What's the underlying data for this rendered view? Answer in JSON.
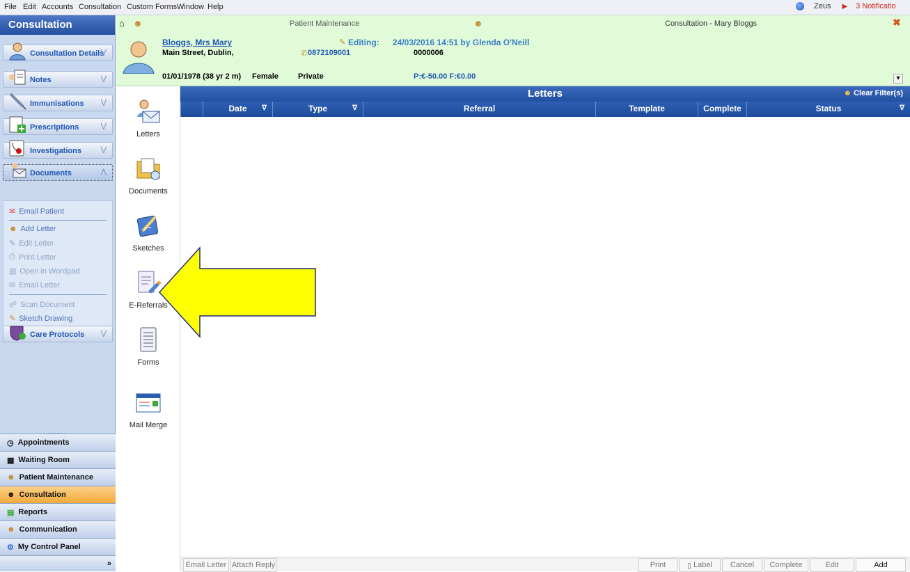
{
  "menu": {
    "items": [
      "File",
      "Edit",
      "Accounts",
      "Consultation",
      "Custom Forms",
      "Window",
      "Help"
    ],
    "user": "Zeus",
    "notifications": "3 Notificatio"
  },
  "sidebar": {
    "title": "Consultation",
    "sections": [
      {
        "label": "Consultation Details",
        "icon": "doctor-icon"
      },
      {
        "label": "Notes",
        "icon": "notes-icon"
      },
      {
        "label": "Immunisations",
        "icon": "syringe-icon"
      },
      {
        "label": "Prescriptions",
        "icon": "prescription-icon"
      },
      {
        "label": "Investigations",
        "icon": "stethoscope-icon"
      },
      {
        "label": "Documents",
        "icon": "documents-icon"
      },
      {
        "label": "Care Protocols",
        "icon": "care-protocols-icon"
      }
    ],
    "doc_items": [
      {
        "label": "Email Patient",
        "enabled": true
      },
      {
        "label": "Add Letter",
        "enabled": true
      },
      {
        "label": "Edit Letter",
        "enabled": false
      },
      {
        "label": "Print Letter",
        "enabled": false
      },
      {
        "label": "Open in Wordpad",
        "enabled": false
      },
      {
        "label": "Email Letter",
        "enabled": false
      },
      {
        "label": "Scan Document",
        "enabled": false
      },
      {
        "label": "Sketch Drawing",
        "enabled": true
      }
    ],
    "nav": [
      {
        "label": "Appointments",
        "active": false
      },
      {
        "label": "Waiting Room",
        "active": false
      },
      {
        "label": "Patient Maintenance",
        "active": false
      },
      {
        "label": "Consultation",
        "active": true
      },
      {
        "label": "Reports",
        "active": false
      },
      {
        "label": "Communication",
        "active": false
      },
      {
        "label": "My Control Panel",
        "active": false
      }
    ],
    "grip": "..........",
    "expand": "»"
  },
  "patient": {
    "tab_patient_maintenance": "Patient Maintenance",
    "tab_consultation": "Consultation - Mary Bloggs",
    "name": "Bloggs, Mrs Mary",
    "address": "Main Street, Dublin,",
    "phone": "0872109001",
    "editing_label": "Editing:",
    "editing_info": "24/03/2016 14:51 by Glenda O'Neill",
    "number": "0000006",
    "dob": "01/01/1978 (38 yr 2 m)",
    "sex": "Female",
    "type": "Private",
    "balance": "P:€-50.00 F:€0.00"
  },
  "icon_column": [
    {
      "label": "Letters",
      "icon": "letters-icon"
    },
    {
      "label": "Documents",
      "icon": "documents-folder-icon"
    },
    {
      "label": "Sketches",
      "icon": "sketches-icon"
    },
    {
      "label": "E-Referrals",
      "icon": "e-referrals-icon"
    },
    {
      "label": "Forms",
      "icon": "forms-icon"
    },
    {
      "label": "Mail Merge",
      "icon": "mail-merge-icon"
    }
  ],
  "main": {
    "title": "Letters",
    "clear_filters": "Clear Filter(s)",
    "columns": [
      "Date",
      "Type",
      "Referral",
      "Template",
      "Complete",
      "Status"
    ],
    "filter_glyph": "∇"
  },
  "bottom": {
    "left": [
      {
        "label": "Email Letter",
        "enabled": false
      },
      {
        "label": "Attach Reply",
        "enabled": false
      }
    ],
    "right": [
      {
        "label": "Print",
        "enabled": false
      },
      {
        "label": "Label",
        "enabled": false
      },
      {
        "label": "Cancel",
        "enabled": false
      },
      {
        "label": "Complete",
        "enabled": false
      },
      {
        "label": "Edit",
        "enabled": false
      },
      {
        "label": "Add",
        "enabled": true
      }
    ]
  },
  "colors": {
    "sidebar_bg": "#c8d8ee",
    "header_blue": "#22509f",
    "patient_bg": "#e1fbd9",
    "active_nav": "#f3a93a",
    "arrow_fill": "#ffff00",
    "notification_red": "#d4281c"
  }
}
